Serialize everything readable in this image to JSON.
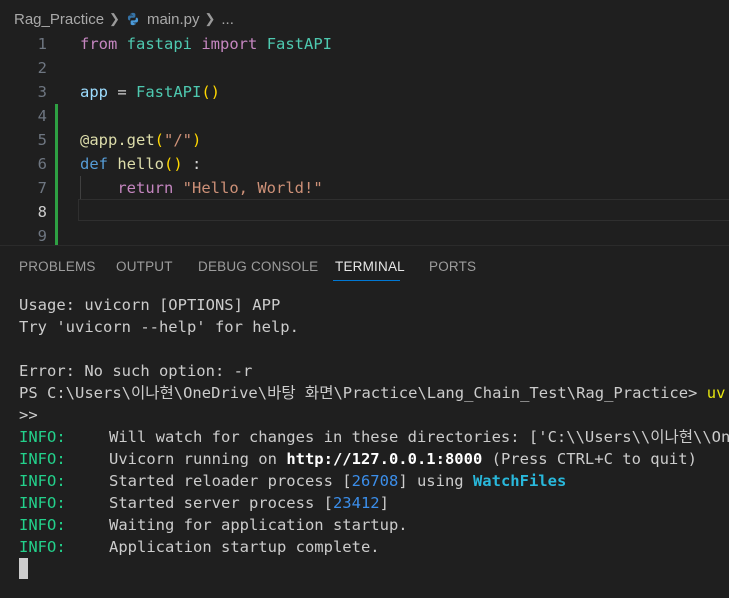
{
  "breadcrumb": {
    "folder": "Rag_Practice",
    "file": "main.py",
    "ellipsis": "..."
  },
  "editor": {
    "line_numbers": [
      "1",
      "2",
      "3",
      "4",
      "5",
      "6",
      "7",
      "8",
      "9"
    ],
    "active_line": "8",
    "code": {
      "l1_from": "from",
      "l1_module": "fastapi",
      "l1_import": "import",
      "l1_class": "FastAPI",
      "l3_var": "app",
      "l3_eq": " = ",
      "l3_class": "FastAPI",
      "l3_parens": "()",
      "l5_deco": "@app.get",
      "l5_open": "(",
      "l5_str": "\"/\"",
      "l5_close": ")",
      "l6_def": "def",
      "l6_fn": "hello",
      "l6_parens": "()",
      "l6_colon": " :",
      "l7_return": "return",
      "l7_str": "\"Hello, World!\""
    }
  },
  "panel": {
    "tabs": [
      "PROBLEMS",
      "OUTPUT",
      "DEBUG CONSOLE",
      "TERMINAL",
      "PORTS"
    ],
    "active_tab": "TERMINAL"
  },
  "terminal": {
    "usage": "Usage: uvicorn [OPTIONS] APP",
    "help": "Try 'uvicorn --help' for help.",
    "error": "Error: No such option: -r",
    "prompt": "PS C:\\Users\\이나현\\OneDrive\\바탕 화면\\Practice\\Lang_Chain_Test\\Rag_Practice> ",
    "prompt_cmd": "uv",
    "prompt_cont": ">>",
    "info_label": "INFO:",
    "info1": "Will watch for changes in these directories: ['C:\\\\Users\\\\이나현\\\\One",
    "info2_a": "Uvicorn running on ",
    "info2_url": "http://127.0.0.1:8000",
    "info2_b": " (Press CTRL+C to quit)",
    "info3_a": "Started reloader process [",
    "info3_pid": "26708",
    "info3_b": "] using ",
    "info3_watch": "WatchFiles",
    "info4_a": "Started server process [",
    "info4_pid": "23412",
    "info4_b": "]",
    "info5": "Waiting for application startup.",
    "info6": "Application startup complete."
  },
  "colors": {
    "background": "#1f1f1f",
    "info_green": "#23d18b",
    "pid_blue": "#3b8eea",
    "tab_accent": "#0078d4"
  }
}
